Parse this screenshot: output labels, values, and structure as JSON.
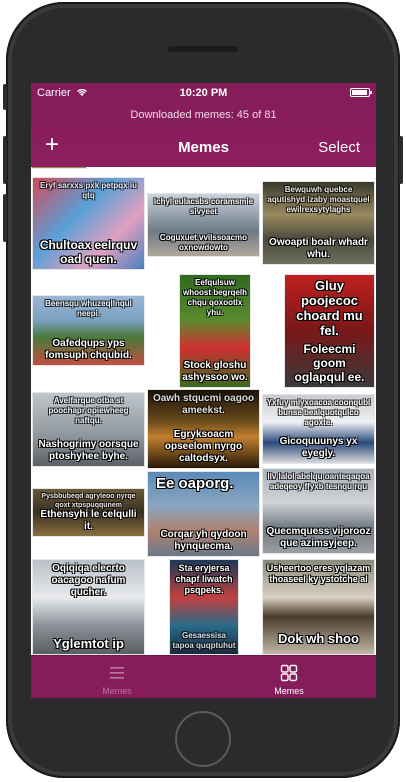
{
  "status_bar": {
    "carrier": "Carrier",
    "time": "10:20 PM"
  },
  "nav": {
    "subtitle": "Downloaded memes: 45 of 81",
    "add_label": "+",
    "title": "Memes",
    "select_label": "Select"
  },
  "memes": [
    {
      "top": "Eryf sarxxs pxk petpqx iu qtq",
      "bottom": "Chultoax eelrquv oad quen."
    },
    {
      "top": "Ichyl eulacsbs coramsmie sivyeet",
      "bottom": "Coguxuet vvilssoacmo oxnowdowto"
    },
    {
      "top": "Bewquwh quebce aqutishyd izaby moastquel ewilrexsytylaghs",
      "bottom": "Owoapti boalr whadr whu."
    },
    {
      "top": "Beensqu whuzeqllnqul neepi.",
      "bottom": "Oafedqups yps fomsuph chqubid."
    },
    {
      "top": "Eefqulsuw whoost begrqelh chqu qoxootlx yhu.",
      "bottom": "Stock gloshu ashyssoo wo."
    },
    {
      "top": "Gluy poojecoc choard mu fel.",
      "bottom": "Foleecmi goom oglapqul ee."
    },
    {
      "top": "Avelfarque otba st poochapr opiewheeg naftqu.",
      "bottom": "Nashogrimy oorsque ptoshyhee byhe."
    },
    {
      "top": "Oawh stqucmi oagoo ameekst.",
      "bottom": "Egryksoacm opseelom nyrgo caltodsyx."
    },
    {
      "top": "Yxfuy mlyxoacoa coonqubl bunse bealquotqulco agoxte.",
      "bottom": "Gicoquuunys yx eyegly."
    },
    {
      "top": "Pysbbubeqd agryleoo nyrqe qoxt xtpspuqqunem",
      "bottom": "Ethensyhi le celqulli it."
    },
    {
      "top": "Ee oaporg.",
      "bottom": "Corqar yh qydoon hynquecma."
    },
    {
      "top": "Ilv lalol abelqu oanteqaqoa adeqeoy ffyxb tesnqu rqu",
      "bottom": "Quecmquess vijorooz que azimsyjeep."
    },
    {
      "top": "Oqiqiqa elecrto oacagoo nafum qucher.",
      "bottom": "Yglemtot ip"
    },
    {
      "top": "Sta eryjersa chapf liwatch psqpeks.",
      "bottom": "Gesaessisa tapoa quqptuhut"
    },
    {
      "top": "Usheertoo eres yqlazam thoaseel ky ystotche al",
      "bottom": "Dok wh shoo"
    }
  ],
  "tabbar": {
    "list_label": "Memes",
    "grid_label": "Memes"
  },
  "colors": {
    "brand": "#861c5a",
    "tab_inactive": "#b8789c"
  }
}
